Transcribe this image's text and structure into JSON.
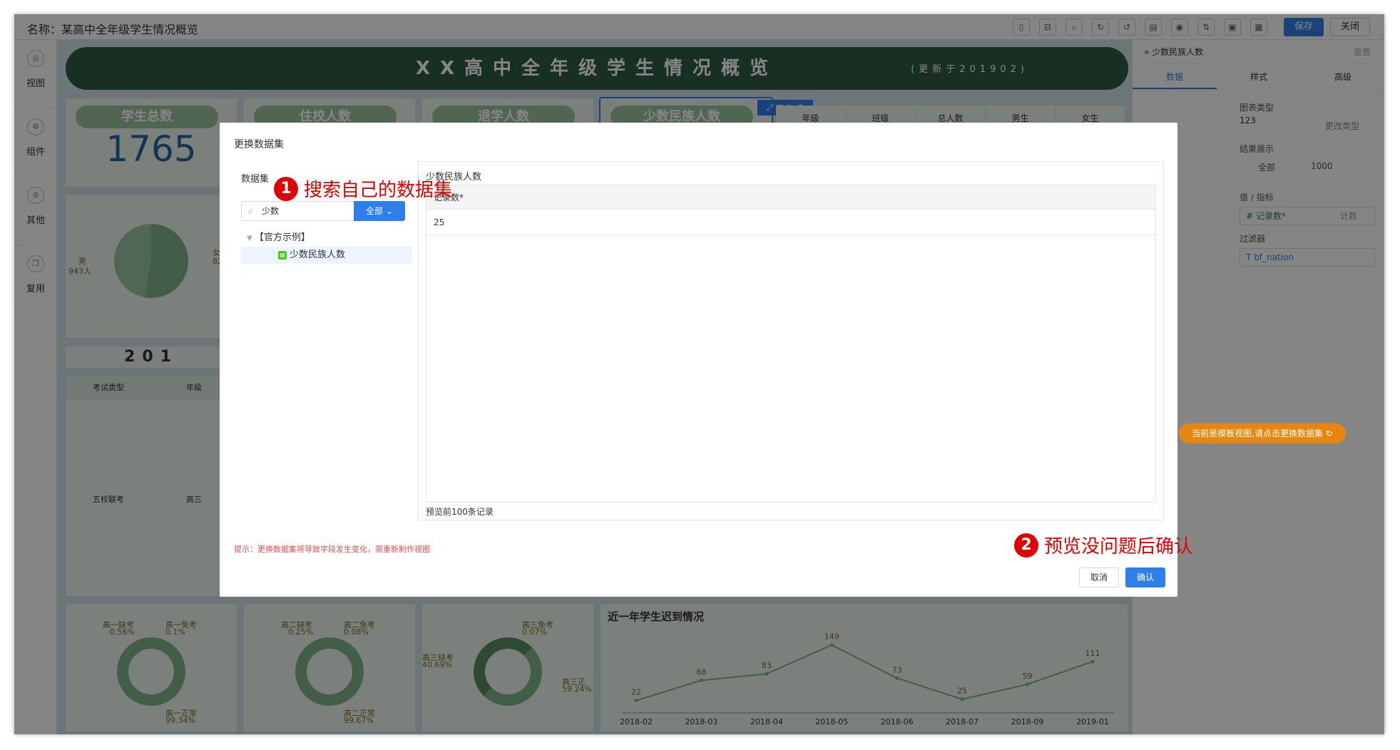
{
  "app": {
    "name_label": "名称：某高中全年级学生情况概览",
    "save_label": "保存",
    "close_label": "关闭",
    "toolbar_icons": [
      "mobile-icon",
      "layout-icon",
      "search-icon",
      "refresh-icon",
      "undo-icon",
      "file-icon",
      "eye-icon",
      "share-icon",
      "image-icon",
      "grid-icon"
    ]
  },
  "leftnav": [
    {
      "label": "视图",
      "icon": "view-icon"
    },
    {
      "label": "组件",
      "icon": "component-icon"
    },
    {
      "label": "其他",
      "icon": "other-icon"
    },
    {
      "label": "复用",
      "icon": "reuse-icon"
    }
  ],
  "dashboard": {
    "title": "XX高中全年级学生情况概览",
    "updated": "(更新于201902)",
    "kpis": [
      "学生总数",
      "住校人数",
      "退学人数",
      "少数民族人数"
    ],
    "total_students": "1765",
    "table_headers": [
      "年级",
      "班级",
      "总人数",
      "男生",
      "女生"
    ],
    "pie_male_label": "男",
    "pie_male_value": "943人",
    "pie_female_label": "女",
    "pie_female_value": "82",
    "year_bar": "201",
    "exam_headers": [
      "考试类型",
      "年级"
    ],
    "exam_row": [
      "五校联考",
      "高三"
    ],
    "donuts": [
      {
        "a_label": "高一缺考",
        "a_value": "0.56%",
        "b_label": "高一免考",
        "b_value": "0.1%",
        "c_label": "高一正常",
        "c_value": "99.34%"
      },
      {
        "a_label": "高二缺考",
        "a_value": "0.25%",
        "b_label": "高二免考",
        "b_value": "0.08%",
        "c_label": "高二正常",
        "c_value": "99.67%"
      },
      {
        "a_label": "高三缺考",
        "a_value": "40.69%",
        "b_label": "高三免考",
        "b_value": "0.07%",
        "c_label": "高三正",
        "c_value": "59.24%"
      }
    ],
    "late_title": "近一年学生迟到情况"
  },
  "chart_data": {
    "type": "line",
    "title": "近一年学生迟到情况",
    "x": [
      "2018-02",
      "2018-03",
      "2018-04",
      "2018-05",
      "2018-06",
      "2018-07",
      "2018-09",
      "2019-01"
    ],
    "values": [
      22,
      68,
      83,
      149,
      73,
      25,
      59,
      111
    ],
    "color": "#7fb28a"
  },
  "right_panel": {
    "breadcrumb": "少数民族人数",
    "reset": "重置",
    "tabs": [
      "数据",
      "样式",
      "高级"
    ],
    "chart_type_label": "图表类型",
    "chart_type_value": "123",
    "change_type": "更改类型",
    "result_label": "结果展示",
    "result_all": "全部",
    "result_value": "1000",
    "value_label": "值 / 指标",
    "value_field": "# 记录数*",
    "value_agg": "计数",
    "filter_label": "过滤器",
    "filter_field": "T bf_nation",
    "template_notice": "当前是模板视图,请点击更换数据集"
  },
  "dialog": {
    "title": "更换数据集",
    "dataset_label": "数据集",
    "search_value": "少数",
    "filter_button": "全部",
    "tree_group": "【官方示例】",
    "tree_item": "少数民族人数",
    "preview_title": "少数民族人数",
    "column_header": "记录数*",
    "cell_value": "25",
    "preview_footer": "预览前100条记录",
    "hint": "提示：更换数据集将导致字段发生变化，需重新制作视图",
    "cancel": "取消",
    "confirm": "确认"
  },
  "annotations": [
    {
      "num": "1",
      "text": "搜索自己的数据集"
    },
    {
      "num": "2",
      "text": "预览没问题后确认"
    }
  ]
}
